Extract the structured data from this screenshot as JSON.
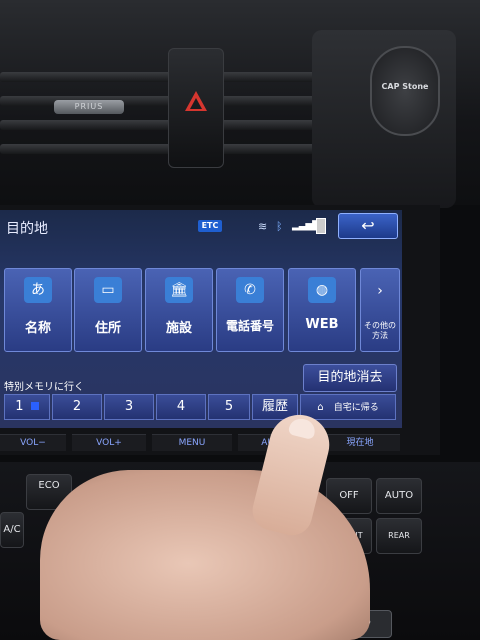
{
  "dash": {
    "vent_badge_left": "PRIUS",
    "mount_brand": "CAP Stone"
  },
  "nav": {
    "title": "目的地",
    "etc_label": "ETC",
    "back_symbol": "↩",
    "tiles": [
      {
        "label": "名称",
        "glyph": "あ"
      },
      {
        "label": "住所",
        "glyph": "▭"
      },
      {
        "label": "施設",
        "glyph": "🏛"
      },
      {
        "label": "電話番号",
        "glyph": "✆"
      },
      {
        "label": "WEB",
        "glyph": "◍"
      }
    ],
    "more_label": "その他の方法",
    "more_arrow": "›",
    "memory_header": "特別メモリに行く",
    "clear_label": "目的地消去",
    "memory_buttons": [
      "1",
      "2",
      "3",
      "4",
      "5"
    ],
    "history_label": "履歴",
    "home_label": "自宅に帰る"
  },
  "hardware": {
    "vol_down": "VOL−",
    "vol_up": "VOL+",
    "menu": "MENU",
    "audio": "AUDIO",
    "current": "現在地"
  },
  "climate": {
    "eco": "ECO",
    "ac": "A/C",
    "off": "OFF",
    "auto": "AUTO",
    "front": "FRONT",
    "rear": "REAR",
    "p": "P"
  },
  "colors": {
    "screen_blue": "#27386a",
    "etc_blue": "#1f5fd0",
    "hazard_red": "#d6362f"
  }
}
